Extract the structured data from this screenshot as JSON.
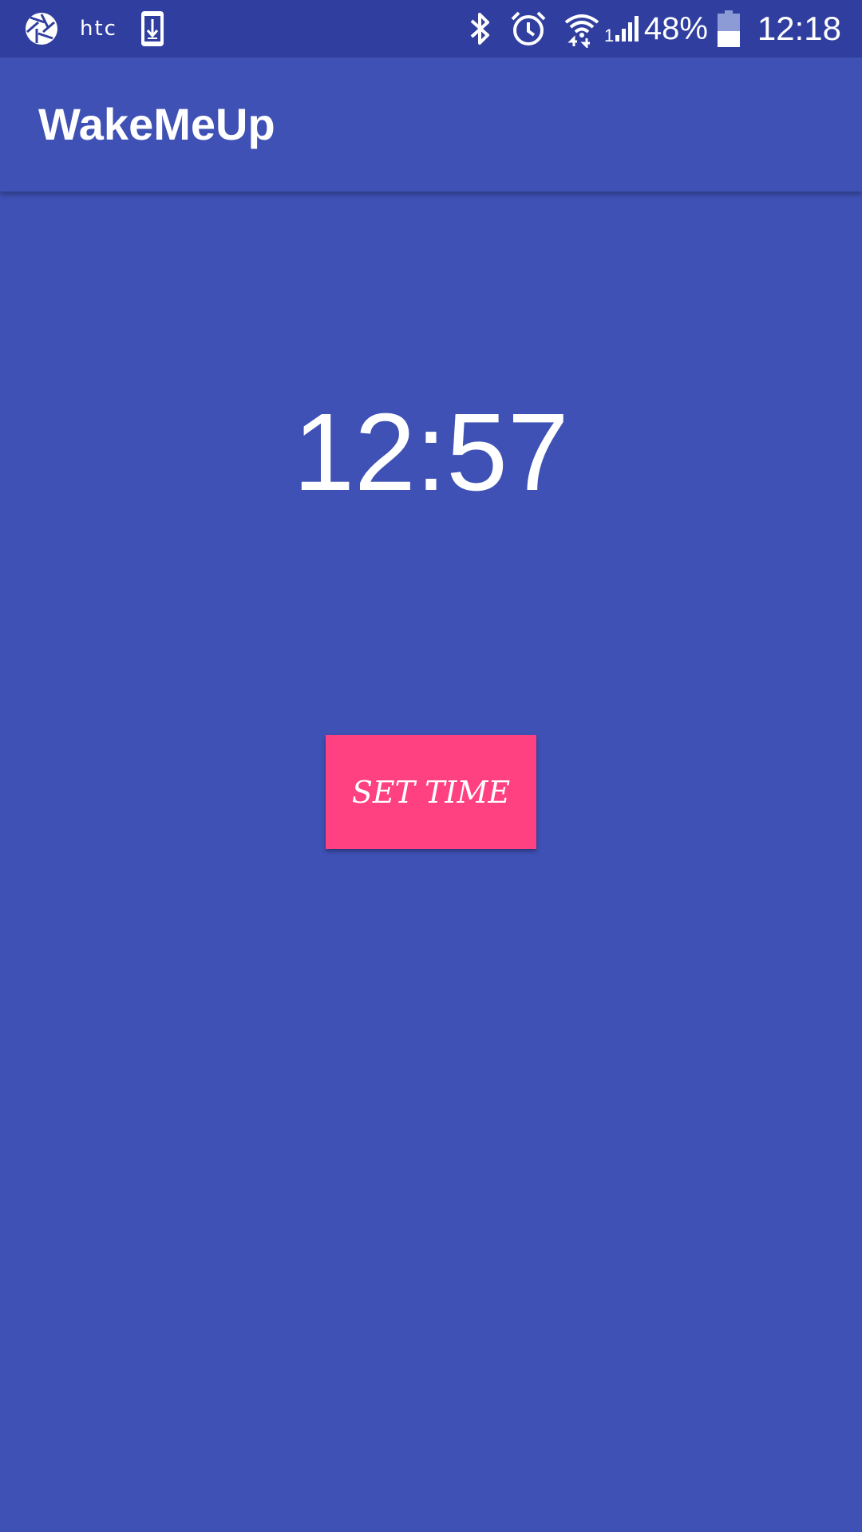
{
  "status_bar": {
    "brand": "htc",
    "battery_percent": "48%",
    "clock": "12:18",
    "icons": [
      "aperture-icon",
      "download-phone-icon",
      "bluetooth-icon",
      "alarm-icon",
      "wifi-icon",
      "signal-icon",
      "battery-icon"
    ],
    "battery_level": 0.48,
    "signal_label": "1"
  },
  "app_bar": {
    "title": "WakeMeUp"
  },
  "main": {
    "time": "12:57",
    "button_label": "SET TIME"
  },
  "colors": {
    "primary": "#3F51B5",
    "primary_dark": "#303F9F",
    "accent": "#FF4081",
    "text": "#FFFFFF"
  }
}
